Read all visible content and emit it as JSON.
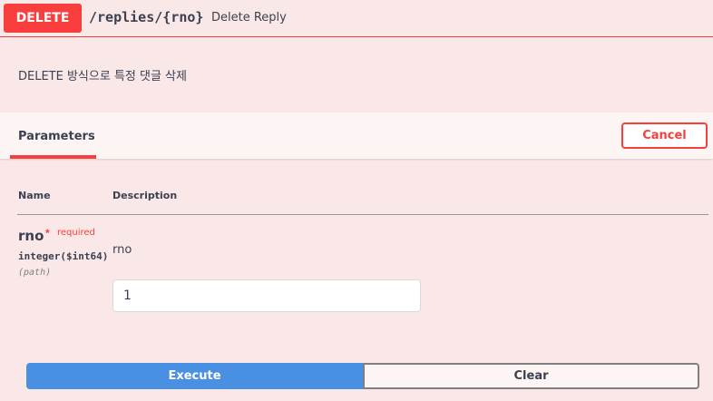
{
  "operation": {
    "method": "DELETE",
    "path": "/replies/{rno}",
    "summary": "Delete Reply",
    "description": "DELETE 방식으로 특정 댓글 삭제"
  },
  "parameters_section": {
    "tab_label": "Parameters",
    "cancel_label": "Cancel",
    "columns": {
      "name": "Name",
      "description": "Description"
    },
    "params": [
      {
        "name": "rno",
        "required_star": "*",
        "required_label": "required",
        "type": "integer($int64)",
        "in": "(path)",
        "description": "rno",
        "value": "1"
      }
    ]
  },
  "actions": {
    "execute_label": "Execute",
    "clear_label": "Clear"
  },
  "colors": {
    "delete_accent": "#f93e3e",
    "execute_blue": "#4990e2",
    "background": "#fae7e7"
  }
}
